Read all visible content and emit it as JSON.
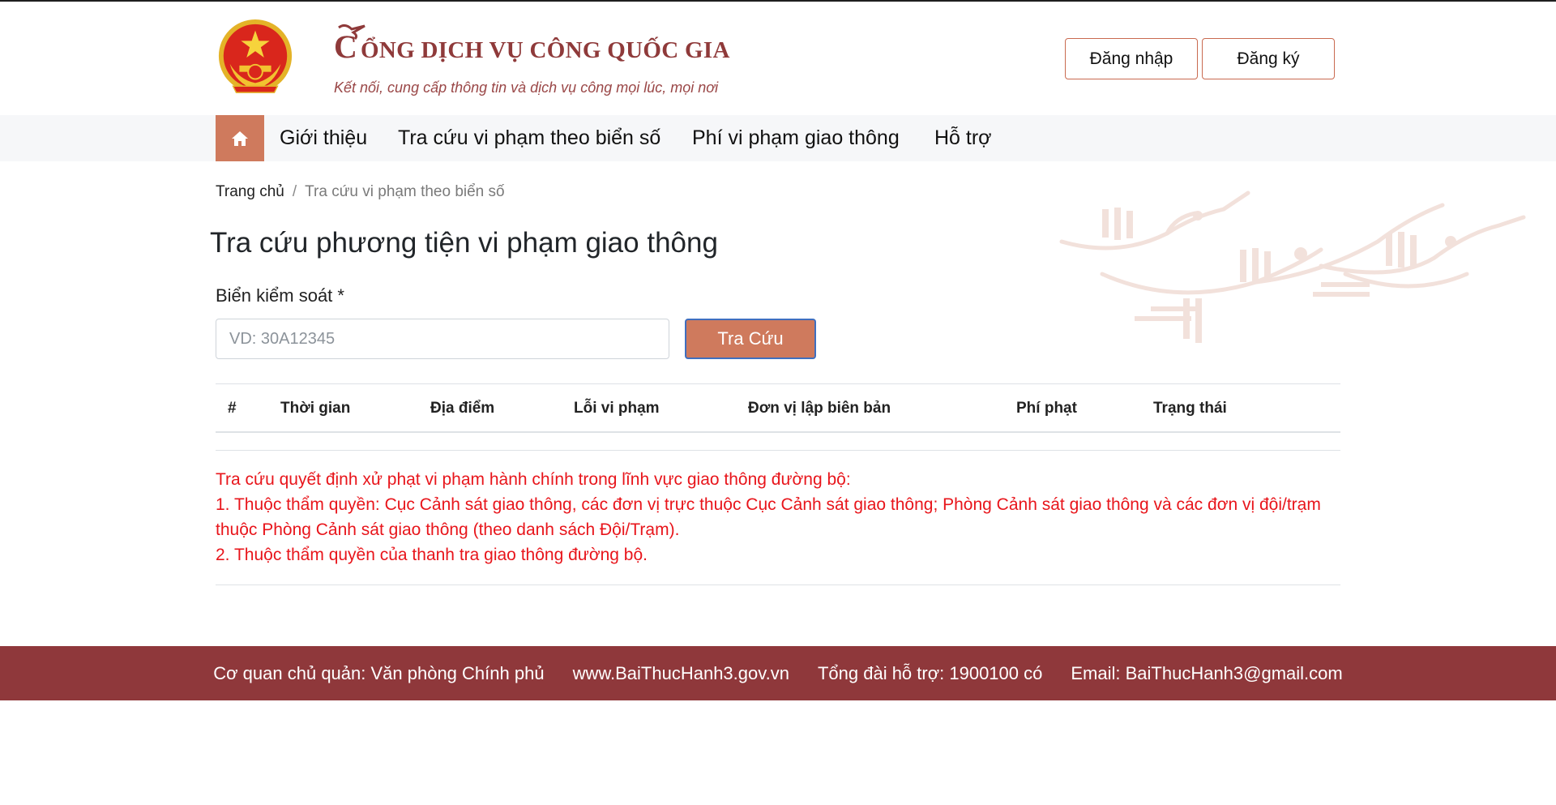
{
  "header": {
    "title_initial": "C",
    "title_rest": "ỔNG DỊCH VỤ CÔNG QUỐC GIA",
    "slogan": "Kết nối, cung cấp thông tin và dịch vụ công mọi lúc, mọi nơi",
    "login_label": "Đăng nhập",
    "register_label": "Đăng ký"
  },
  "nav": {
    "items": [
      {
        "label": "Giới thiệu"
      },
      {
        "label": "Tra cứu vi phạm theo biển số"
      },
      {
        "label": "Phí vi phạm giao thông"
      },
      {
        "label": "Hỗ trợ"
      }
    ]
  },
  "breadcrumb": {
    "home": "Trang chủ",
    "separator": "/",
    "current": "Tra cứu vi phạm theo biển số"
  },
  "main": {
    "title": "Tra cứu phương tiện vi phạm giao thông",
    "field_label": "Biển kiểm soát *",
    "input_value": "",
    "input_placeholder": "VD: 30A12345",
    "search_label": "Tra Cứu"
  },
  "table": {
    "columns": [
      "#",
      "Thời gian",
      "Địa điểm",
      "Lỗi vi phạm",
      "Đơn vị lập biên bản",
      "Phí phạt",
      "Trạng thái"
    ],
    "rows": []
  },
  "notice": {
    "lines": [
      "Tra cứu quyết định xử phạt vi phạm hành chính trong lĩnh vực giao thông đường bộ:",
      "1. Thuộc thẩm quyền: Cục Cảnh sát giao thông, các đơn vị trực thuộc Cục Cảnh sát giao thông; Phòng Cảnh sát giao thông và các đơn vị đội/trạm thuộc Phòng Cảnh sát giao thông (theo danh sách Đội/Trạm).",
      "2. Thuộc thẩm quyền của thanh tra giao thông đường bộ."
    ]
  },
  "footer": {
    "agency": "Cơ quan chủ quản: Văn phòng Chính phủ",
    "website": "www.BaiThucHanh3.gov.vn",
    "hotline": "Tổng đài hỗ trợ: 1900100 có",
    "email": "Email: BaiThucHanh3@gmail.com"
  },
  "colors": {
    "accent": "#cf7a5d",
    "brand": "#8f383b",
    "notice": "#e8151b"
  },
  "icons": {
    "emblem": "national-emblem-icon",
    "logo": "bird-logo-icon",
    "home": "home-icon",
    "decoration": "lac-bird-decoration"
  }
}
